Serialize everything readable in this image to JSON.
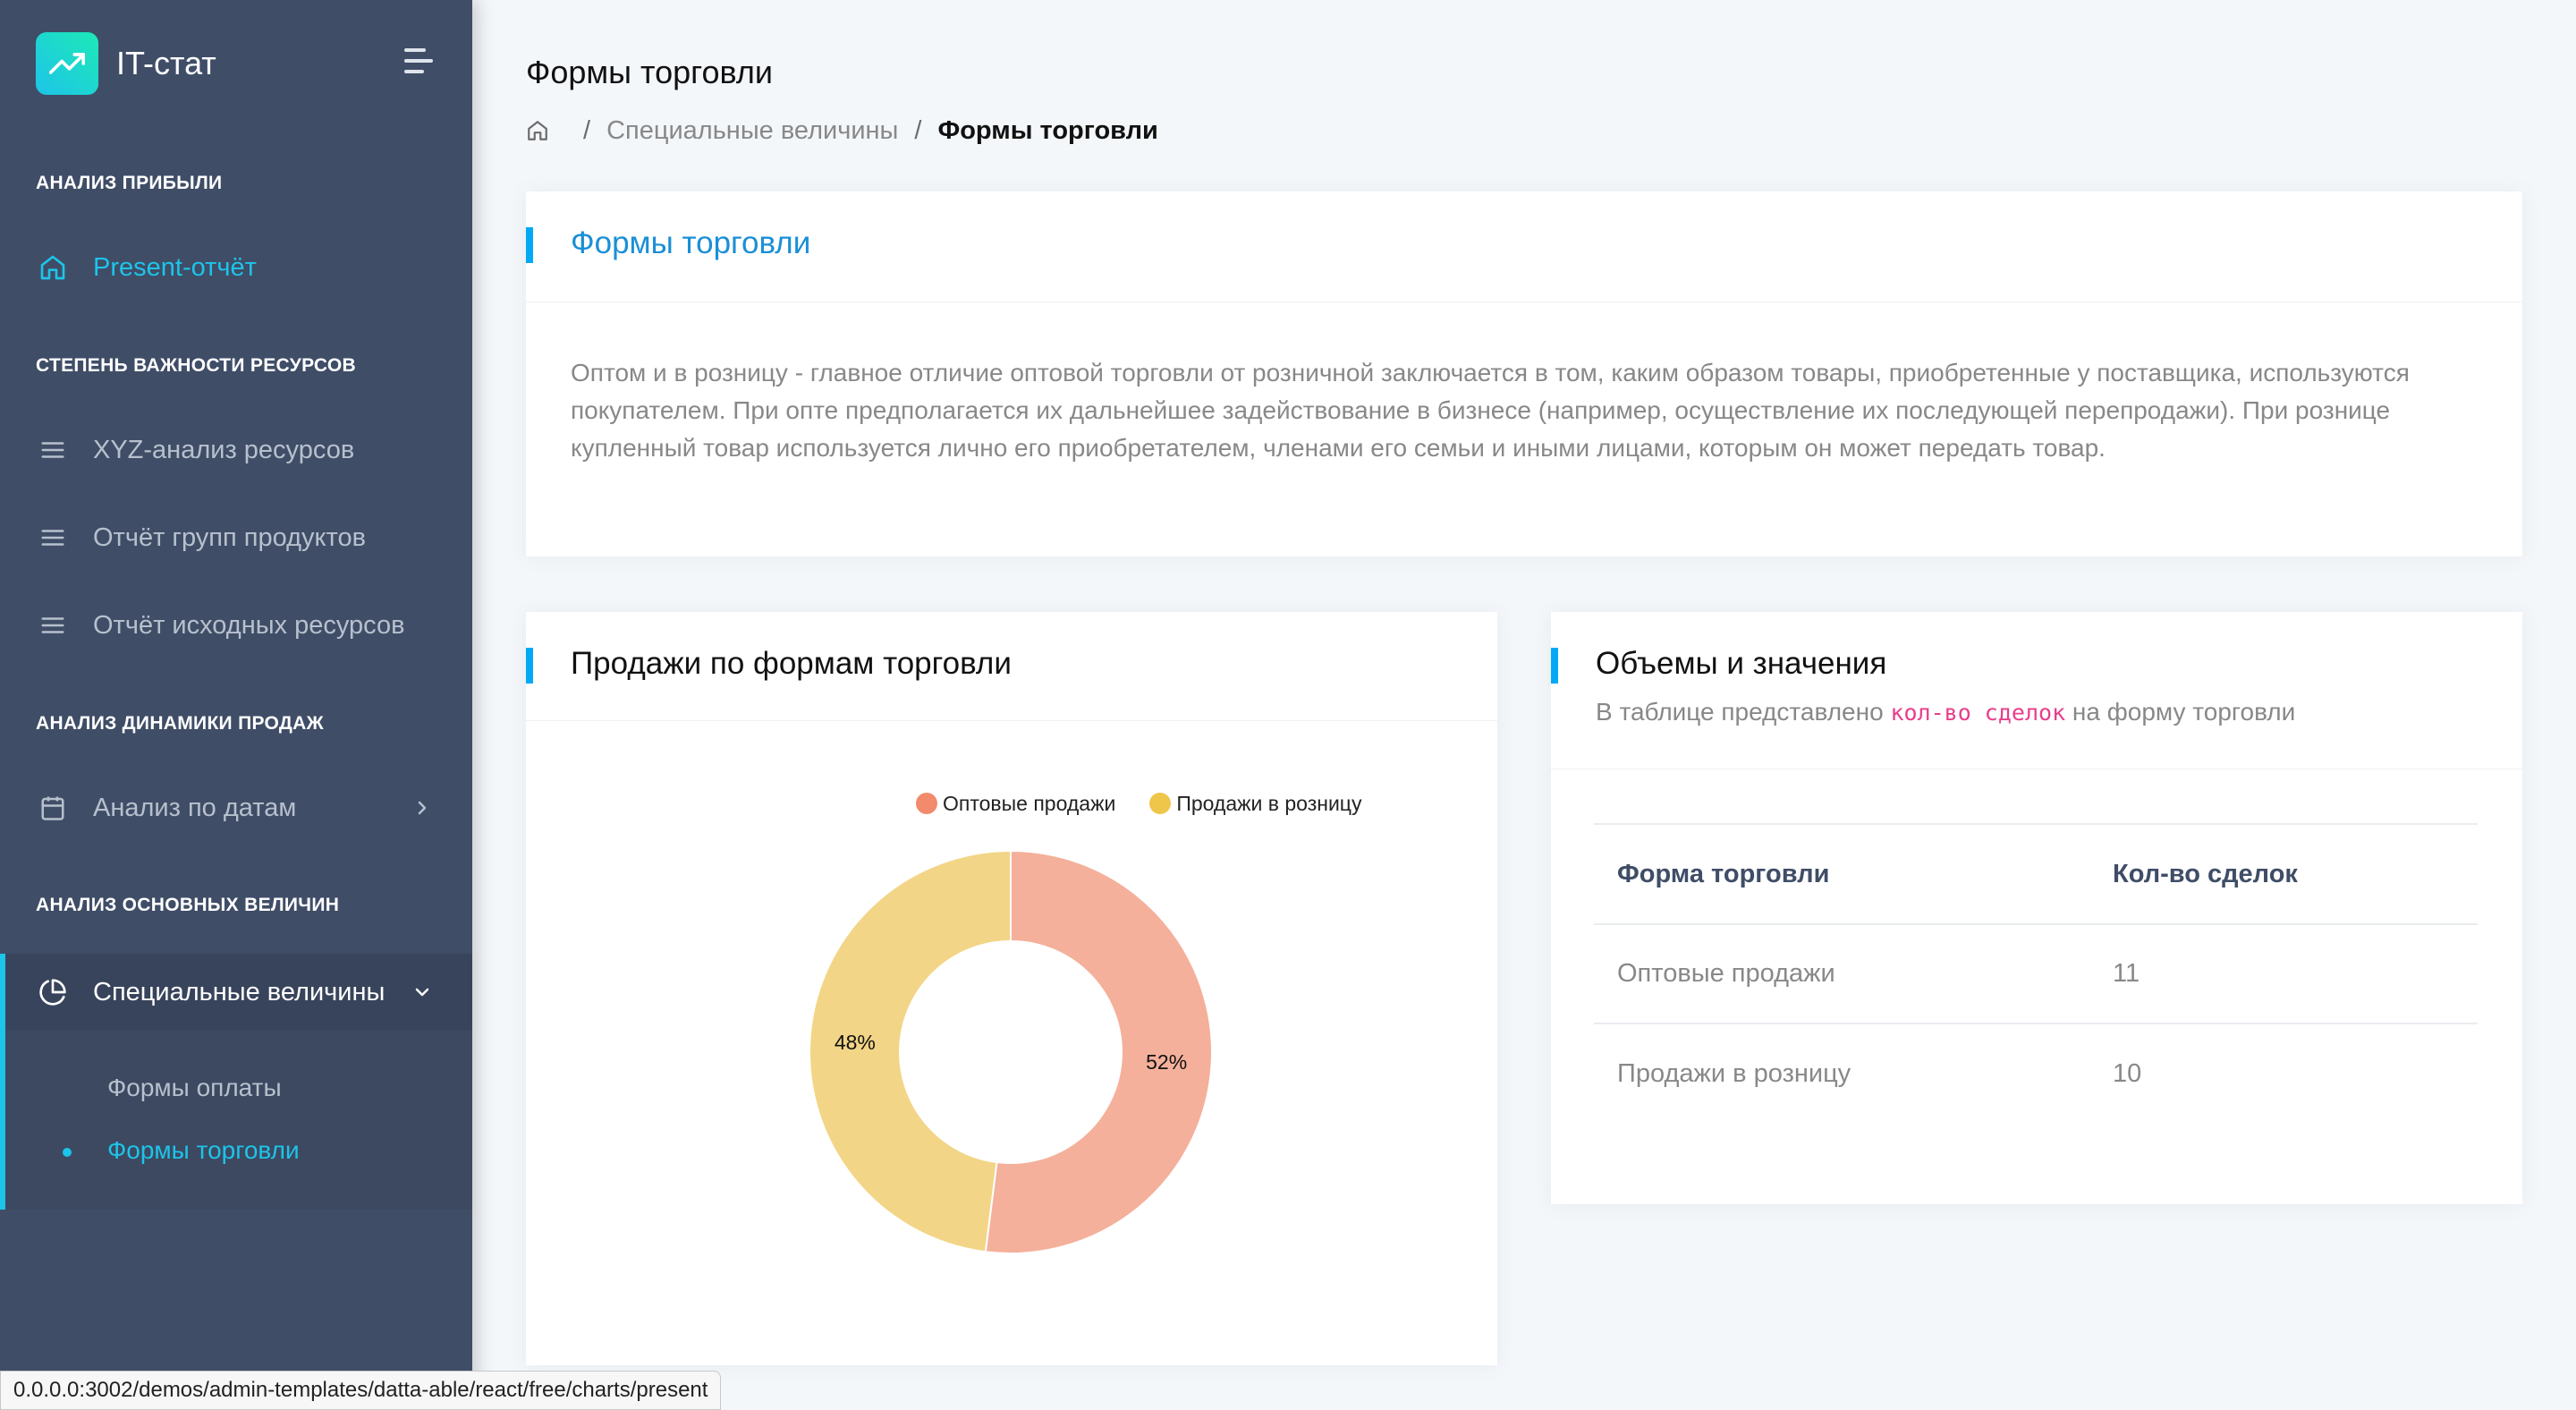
{
  "app": {
    "name": "IT-стат"
  },
  "sidebar": {
    "sections": [
      {
        "caption": "Анализ прибыли"
      },
      {
        "caption": "Степень важности ресурсов"
      },
      {
        "caption": "Анализ динамики продаж"
      },
      {
        "caption": "Анализ основных величин"
      }
    ],
    "items": [
      {
        "label": "Present-отчёт",
        "icon": "home-icon"
      },
      {
        "label": "XYZ-анализ ресурсов",
        "icon": "menu-icon"
      },
      {
        "label": "Отчёт групп продуктов",
        "icon": "menu-icon"
      },
      {
        "label": "Отчёт исходных ресурсов",
        "icon": "menu-icon"
      },
      {
        "label": "Анализ по датам",
        "icon": "calendar-icon"
      },
      {
        "label": "Специальные величины",
        "icon": "pie-chart-icon"
      }
    ],
    "submenu": [
      {
        "label": "Формы оплаты"
      },
      {
        "label": "Формы торговли"
      }
    ]
  },
  "header": {
    "title": "Формы торговли",
    "breadcrumb": [
      "Специальные величины",
      "Формы торговли"
    ],
    "separator": "/"
  },
  "intro_card": {
    "title": "Формы торговли",
    "text": "Оптом и в розницу - главное отличие оптовой торговли от розничной заключается в том, каким образом товары, приобретенные у поставщика, используются покупателем. При опте предполагается их дальнейшее задействование в бизнесе (например, осуществление их последующей перепродажи). При рознице купленный товар используется лично его приобретателем, членами его семьи и иными лицами, которым он может передать товар."
  },
  "chart_card": {
    "title": "Продажи по формам торговли"
  },
  "chart_data": {
    "type": "pie",
    "categories": [
      "Оптовые продажи",
      "Продажи в розницу"
    ],
    "values": [
      52,
      48
    ],
    "labels": [
      "52%",
      "48%"
    ],
    "colors": [
      "#f4b09a",
      "#f2d586"
    ],
    "legend_colors": [
      "#f28a6c",
      "#efc64a"
    ],
    "donut": true,
    "legend_position": "top"
  },
  "table_card": {
    "title": "Объемы и значения",
    "subtitle_before": "В таблице представлено",
    "subtitle_code": "кол-во сделок",
    "subtitle_after": "на форму торговли",
    "columns": [
      "Форма торговли",
      "Кол-во сделок"
    ],
    "rows": [
      [
        "Оптовые продажи",
        "11"
      ],
      [
        "Продажи в розницу",
        "10"
      ]
    ]
  },
  "statusbar": {
    "url": "0.0.0.0:3002/demos/admin-templates/datta-able/react/free/charts/present"
  },
  "colors": {
    "sidebar": "#3f4d67",
    "accent": "#04a9f5",
    "active": "#1dc4e9"
  }
}
